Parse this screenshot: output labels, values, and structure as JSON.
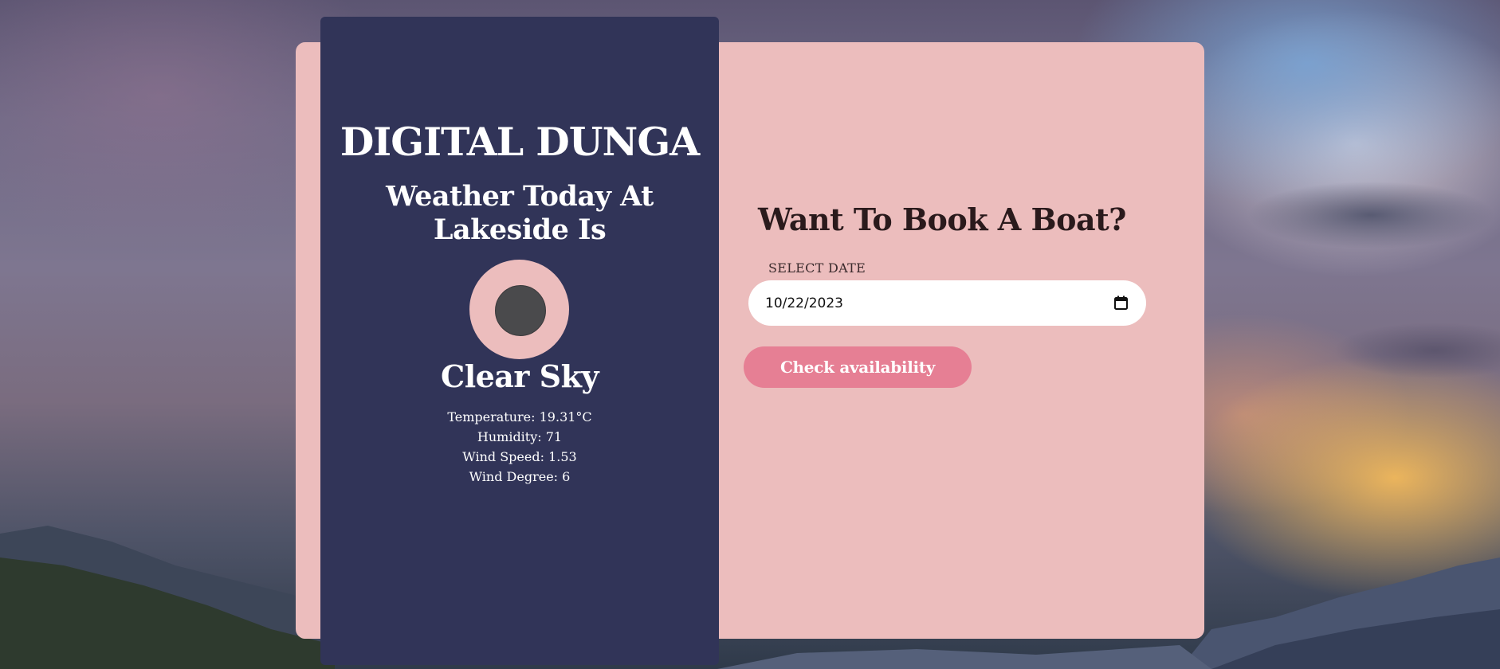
{
  "weather": {
    "brand": "DIGITAL DUNGA",
    "heading": "Weather Today At Lakeside Is",
    "condition": "Clear Sky",
    "icon": "weather-condition-icon",
    "stats": {
      "temperature": "Temperature: 19.31°C",
      "humidity": "Humidity: 71",
      "wind_speed": "Wind Speed: 1.53",
      "wind_degree": "Wind Degree: 6"
    }
  },
  "booking": {
    "title": "Want To Book A Boat?",
    "date_label": "SELECT DATE",
    "date_value": "10/22/2023",
    "date_icon": "calendar-icon",
    "check_button_label": "Check availability"
  },
  "colors": {
    "card_background": "#ecbdbd",
    "weather_panel": "#313458",
    "button": "#e67f94",
    "input_background": "#ffffff",
    "title_text": "#2a1a1c"
  }
}
